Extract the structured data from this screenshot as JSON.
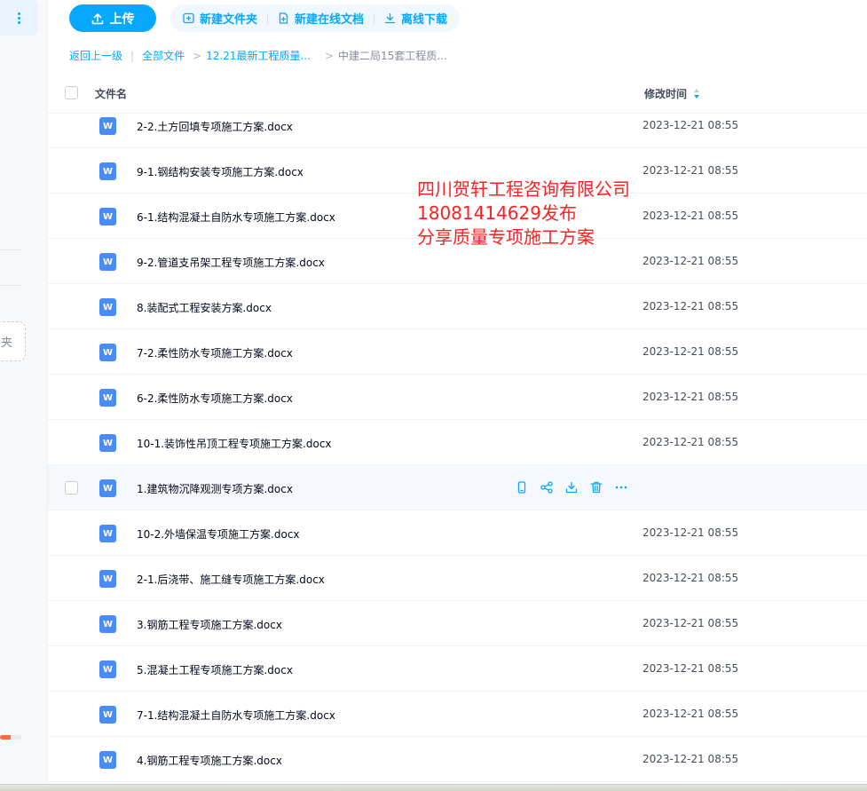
{
  "toolbar": {
    "upload_label": "上传",
    "new_folder_label": "新建文件夹",
    "new_doc_label": "新建在线文档",
    "offline_download_label": "离线下载"
  },
  "sidebar": {
    "new_folder_partial": "夹",
    "quota_used_fraction": 0.5
  },
  "breadcrumb": {
    "back": "返回上一级",
    "all_files": "全部文件",
    "folder": "12.21最新工程质量...",
    "current": "中建二局15套工程质..."
  },
  "table": {
    "col_name": "文件名",
    "col_time": "修改时间"
  },
  "files": [
    {
      "name": "2-2.土方回填专项施工方案.docx",
      "time": "2023-12-21 08:55"
    },
    {
      "name": "9-1.钢结构安装专项施工方案.docx",
      "time": "2023-12-21 08:55"
    },
    {
      "name": "6-1.结构混凝土自防水专项施工方案.docx",
      "time": "2023-12-21 08:55"
    },
    {
      "name": "9-2.管道支吊架工程专项施工方案.docx",
      "time": "2023-12-21 08:55"
    },
    {
      "name": "8.装配式工程安装方案.docx",
      "time": "2023-12-21 08:55"
    },
    {
      "name": "7-2.柔性防水专项施工方案.docx",
      "time": "2023-12-21 08:55"
    },
    {
      "name": "6-2.柔性防水专项施工方案.docx",
      "time": "2023-12-21 08:55"
    },
    {
      "name": "10-1.装饰性吊顶工程专项施工方案.docx",
      "time": "2023-12-21 08:55"
    },
    {
      "name": "1.建筑物沉降观测专项方案.docx",
      "time": ""
    },
    {
      "name": "10-2.外墙保温专项施工方案.docx",
      "time": "2023-12-21 08:55"
    },
    {
      "name": "2-1.后浇带、施工缝专项施工方案.docx",
      "time": "2023-12-21 08:55"
    },
    {
      "name": "3.钢筋工程专项施工方案.docx",
      "time": "2023-12-21 08:55"
    },
    {
      "name": "5.混凝土工程专项施工方案.docx",
      "time": "2023-12-21 08:55"
    },
    {
      "name": "7-1.结构混凝土自防水专项施工方案.docx",
      "time": "2023-12-21 08:55"
    },
    {
      "name": "4.钢筋工程专项施工方案.docx",
      "time": "2023-12-21 08:55"
    }
  ],
  "file_icon_glyph": "W",
  "hover_row_index": 8,
  "watermark": {
    "line1": "四川贺轩工程咨询有限公司",
    "line2": "18081414629发布",
    "line3": "分享质量专项施工方案"
  },
  "colors": {
    "accent": "#06a7ff",
    "word_icon": "#4a8cf6",
    "watermark": "#ff1f1f"
  }
}
